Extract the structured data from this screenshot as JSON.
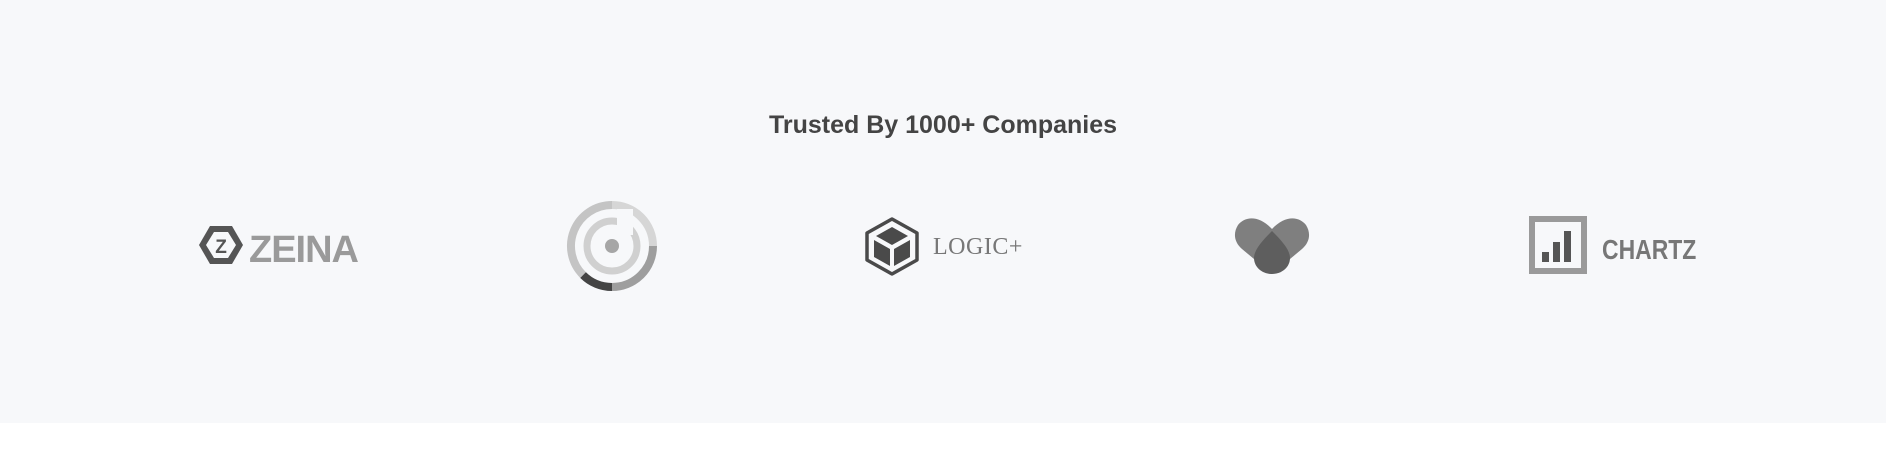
{
  "trusted": {
    "title": "Trusted By 1000+ Companies",
    "logos": [
      {
        "name": "zeina",
        "text": "ZEINA",
        "icon_letter": "Z"
      },
      {
        "name": "target-ring",
        "text": ""
      },
      {
        "name": "logic-plus",
        "text": "LOGIC+"
      },
      {
        "name": "heart",
        "text": ""
      },
      {
        "name": "chartz",
        "text": "CHARTZ"
      }
    ],
    "colors": {
      "background": "#f7f8fa",
      "title": "#444444",
      "logo_dark": "#555555",
      "logo_mid": "#9a9a9a",
      "logo_light": "#d0d0d0"
    }
  }
}
